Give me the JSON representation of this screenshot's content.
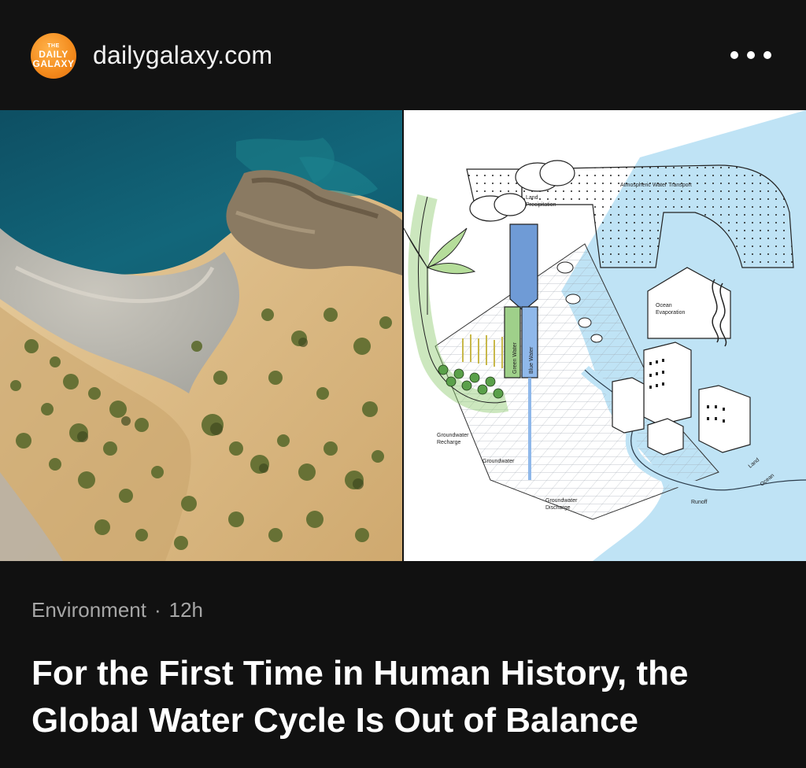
{
  "header": {
    "logo_lines": [
      "THE",
      "DAILY",
      "GALAXY"
    ],
    "source": "dailygalaxy.com",
    "more_icon": "more-horizontal-icon"
  },
  "diagram_labels": {
    "atmospheric": "Atmospheric Water Transport",
    "land_precip_1": "Land",
    "land_precip_2": "Precipitation",
    "ocean_evap_1": "Ocean",
    "ocean_evap_2": "Evaporation",
    "green_water": "Green Water",
    "blue_water": "Blue Water",
    "gw_recharge_1": "Groundwater",
    "gw_recharge_2": "Recharge",
    "groundwater": "Groundwater",
    "gw_discharge_1": "Groundwater",
    "gw_discharge_2": "Discharge",
    "runoff": "Runoff",
    "land": "Land",
    "ocean": "Ocean"
  },
  "article": {
    "category": "Environment",
    "separator": "·",
    "age": "12h",
    "title": "For the First Time in Human History, the Global Water Cycle Is Out of Balance"
  },
  "colors": {
    "background": "#111111",
    "meta_text": "#a6a6a6",
    "logo_orange": "#f38a1c"
  }
}
